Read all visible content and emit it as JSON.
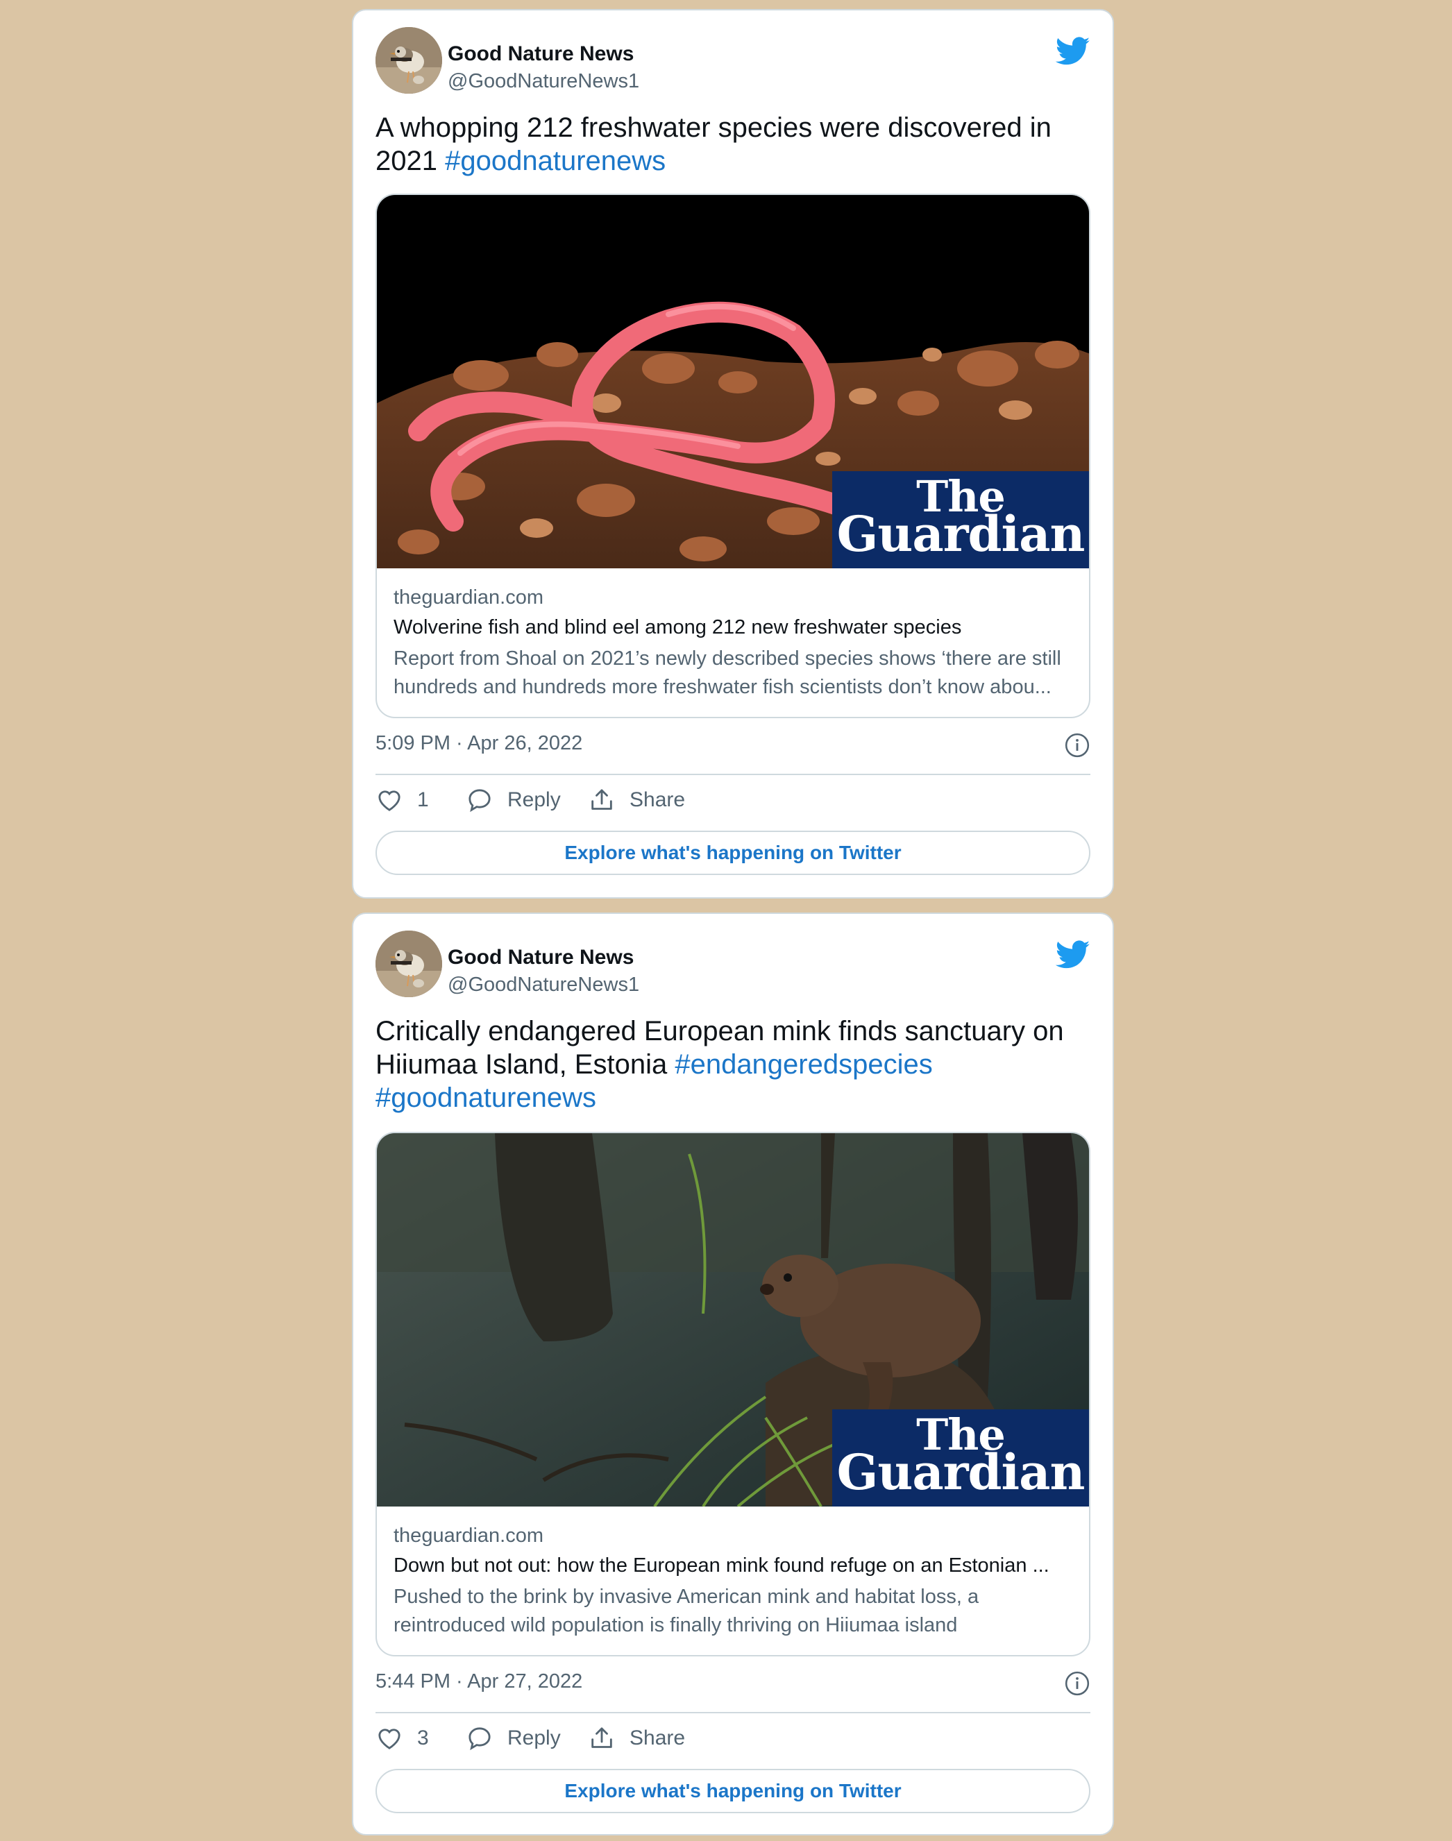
{
  "colors": {
    "background": "#dbc5a4",
    "link": "#1b76c8",
    "twitter_blue": "#1d9bf0",
    "guardian_navy": "#0c2b66"
  },
  "tweets": [
    {
      "author": {
        "name": "Good Nature News",
        "handle": "@GoodNatureNews1",
        "avatar_icon": "plover-bird-avatar"
      },
      "text": "A whopping 212 freshwater species were discovered in 2021 ",
      "hashtags": [
        "#goodnaturenews"
      ],
      "card": {
        "image": "pink-eel-on-gravel-photo",
        "brand_line1": "The",
        "brand_line2": "Guardian",
        "domain": "theguardian.com",
        "title": "Wolverine fish and blind eel among 212 new freshwater species",
        "description": "Report from Shoal on 2021’s newly described species shows ‘there are still hundreds and hundreds more freshwater fish scientists don’t know abou..."
      },
      "timestamp": "5:09 PM · Apr 26, 2022",
      "likes": "1",
      "reply_label": "Reply",
      "share_label": "Share",
      "explore_label": "Explore what's happening on Twitter"
    },
    {
      "author": {
        "name": "Good Nature News",
        "handle": "@GoodNatureNews1",
        "avatar_icon": "plover-bird-avatar"
      },
      "text": "Critically endangered European mink finds sanctuary on Hiiumaa Island, Estonia ",
      "hashtags": [
        "#endangeredspecies",
        "#goodnaturenews"
      ],
      "card": {
        "image": "european-mink-by-water-photo",
        "brand_line1": "The",
        "brand_line2": "Guardian",
        "domain": "theguardian.com",
        "title": "Down but not out: how the European mink found refuge on an Estonian ...",
        "description": "Pushed to the brink by invasive American mink and habitat loss, a reintroduced wild population is finally thriving on Hiiumaa island"
      },
      "timestamp": "5:44 PM · Apr 27, 2022",
      "likes": "3",
      "reply_label": "Reply",
      "share_label": "Share",
      "explore_label": "Explore what's happening on Twitter"
    }
  ]
}
